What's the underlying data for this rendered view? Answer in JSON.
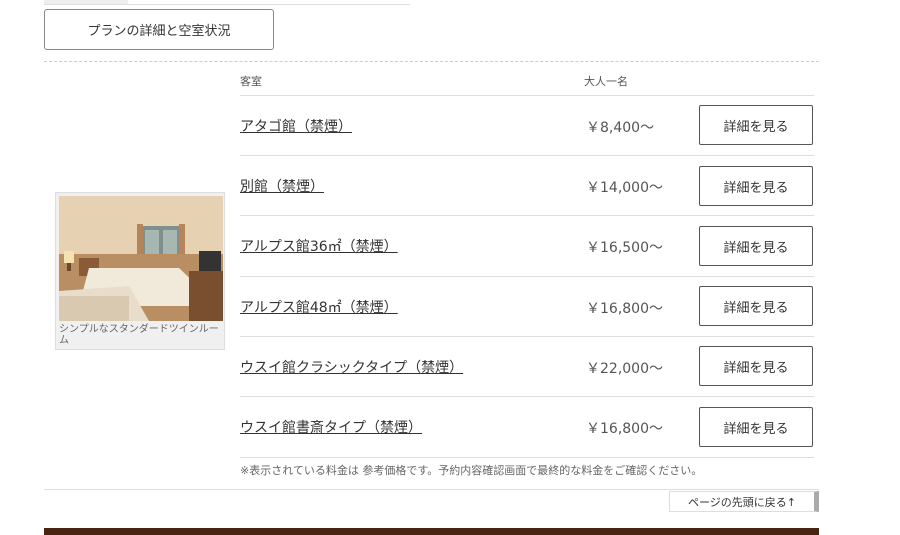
{
  "plan_button_label": "プランの詳細と空室状況",
  "table": {
    "header_room": "客室",
    "header_price": "大人一名",
    "rows": [
      {
        "room": "アタゴ館（禁煙）",
        "price": "￥8,400～",
        "button": "詳細を見る"
      },
      {
        "room": "別館（禁煙）",
        "price": "￥14,000～",
        "button": "詳細を見る"
      },
      {
        "room": "アルプス館36㎡（禁煙）",
        "price": "￥16,500～",
        "button": "詳細を見る"
      },
      {
        "room": "アルプス館48㎡（禁煙）",
        "price": "￥16,800～",
        "button": "詳細を見る"
      },
      {
        "room": "ウスイ館クラシックタイプ（禁煙）",
        "price": "￥22,000～",
        "button": "詳細を見る"
      },
      {
        "room": "ウスイ館書斎タイプ（禁煙）",
        "price": "￥16,800～",
        "button": "詳細を見る"
      }
    ]
  },
  "thumbnail_caption": "シンプルなスタンダードツインルーム",
  "note": "※表示されている料金は 参考価格です。予約内容確認画面で最終的な料金をご確認ください。",
  "back_to_top": "ページの先頭に戻る↑",
  "colors": {
    "bottom_bar": "#4a2413",
    "link_text": "#333333"
  }
}
